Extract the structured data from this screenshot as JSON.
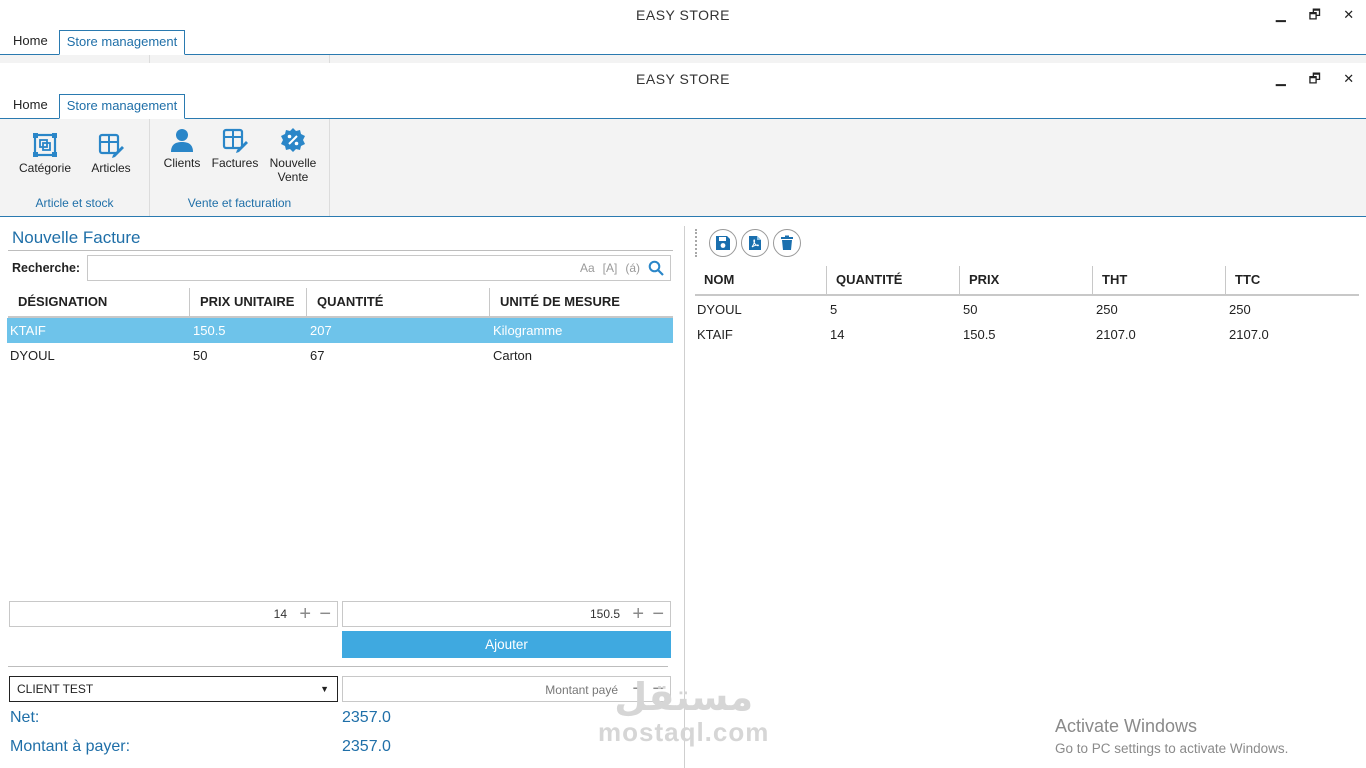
{
  "app_title": "EASY STORE",
  "window_controls": {
    "minimize": "▁",
    "restore": "🗗",
    "close": "✕"
  },
  "tabs": [
    {
      "label": "Home"
    },
    {
      "label": "Store management"
    }
  ],
  "ribbon": {
    "groups": [
      {
        "title": "Article et stock",
        "buttons": [
          {
            "label": "Catégorie",
            "icon": "category-icon"
          },
          {
            "label": "Articles",
            "icon": "articles-icon"
          }
        ]
      },
      {
        "title": "Vente et facturation",
        "buttons": [
          {
            "label": "Clients",
            "icon": "clients-icon"
          },
          {
            "label": "Factures",
            "icon": "invoices-icon"
          },
          {
            "label": "Nouvelle",
            "label2": "Vente",
            "icon": "new-sale-icon"
          }
        ]
      }
    ]
  },
  "left": {
    "title": "Nouvelle Facture",
    "search": {
      "label": "Recherche:",
      "value": "",
      "opt_case": "Aa",
      "opt_word": "[A]",
      "opt_accent": "(á)"
    },
    "columns": [
      "DÉSIGNATION",
      "PRIX UNITAIRE",
      "QUANTITÉ",
      "UNITÉ DE MESURE"
    ],
    "rows": [
      {
        "designation": "KTAIF",
        "prix": "150.5",
        "quantite": "207",
        "unite": "Kilogramme",
        "selected": true
      },
      {
        "designation": "DYOUL",
        "prix": "50",
        "quantite": "67",
        "unite": "Carton",
        "selected": false
      }
    ],
    "qty_stepper": "14",
    "price_stepper": "150.5",
    "add_button": "Ajouter",
    "client": "CLIENT TEST",
    "paid_placeholder": "Montant payé",
    "net_label": "Net:",
    "net_value": "2357.0",
    "to_pay_label": "Montant à payer:",
    "to_pay_value": "2357.0"
  },
  "right": {
    "columns": [
      "NOM",
      "QUANTITÉ",
      "PRIX",
      "THT",
      "TTC"
    ],
    "rows": [
      {
        "nom": "DYOUL",
        "quantite": "5",
        "prix": "50",
        "tht": "250",
        "ttc": "250"
      },
      {
        "nom": "KTAIF",
        "quantite": "14",
        "prix": "150.5",
        "tht": "2107.0",
        "ttc": "2107.0"
      }
    ]
  },
  "os_notice": {
    "line1": "Activate Windows",
    "line2": "Go to PC settings to activate Windows."
  },
  "watermark": {
    "arabic": "مستقل",
    "latin": "mostaql.com"
  },
  "colors": {
    "accent": "#1f6fa8",
    "selection": "#6ec3ea",
    "button": "#3fa9e0"
  }
}
